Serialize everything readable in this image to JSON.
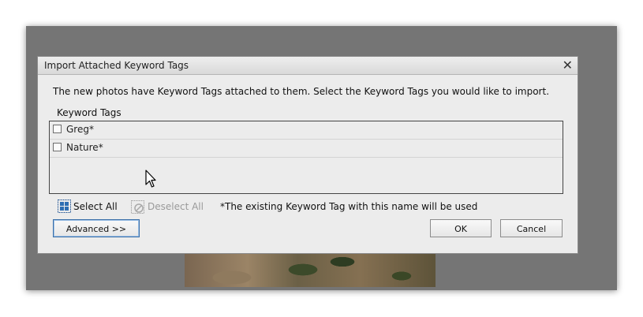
{
  "dialog": {
    "title": "Import Attached Keyword Tags",
    "close_symbol": "✕",
    "message": "The new photos have Keyword Tags attached to them.  Select the Keyword Tags you would like to import.",
    "list_label": "Keyword Tags",
    "items": [
      {
        "label": "Greg*",
        "checked": false
      },
      {
        "label": "Nature*",
        "checked": false
      }
    ],
    "select_all": "Select All",
    "deselect_all": "Deselect All",
    "note": "*The existing Keyword Tag with this name will be used",
    "buttons": {
      "advanced": "Advanced >>",
      "ok": "OK",
      "cancel": "Cancel"
    }
  },
  "icons": {
    "select_all": "select-all-icon",
    "deselect_all": "deselect-all-icon",
    "cursor": "mouse-pointer-icon",
    "close": "close-icon"
  }
}
